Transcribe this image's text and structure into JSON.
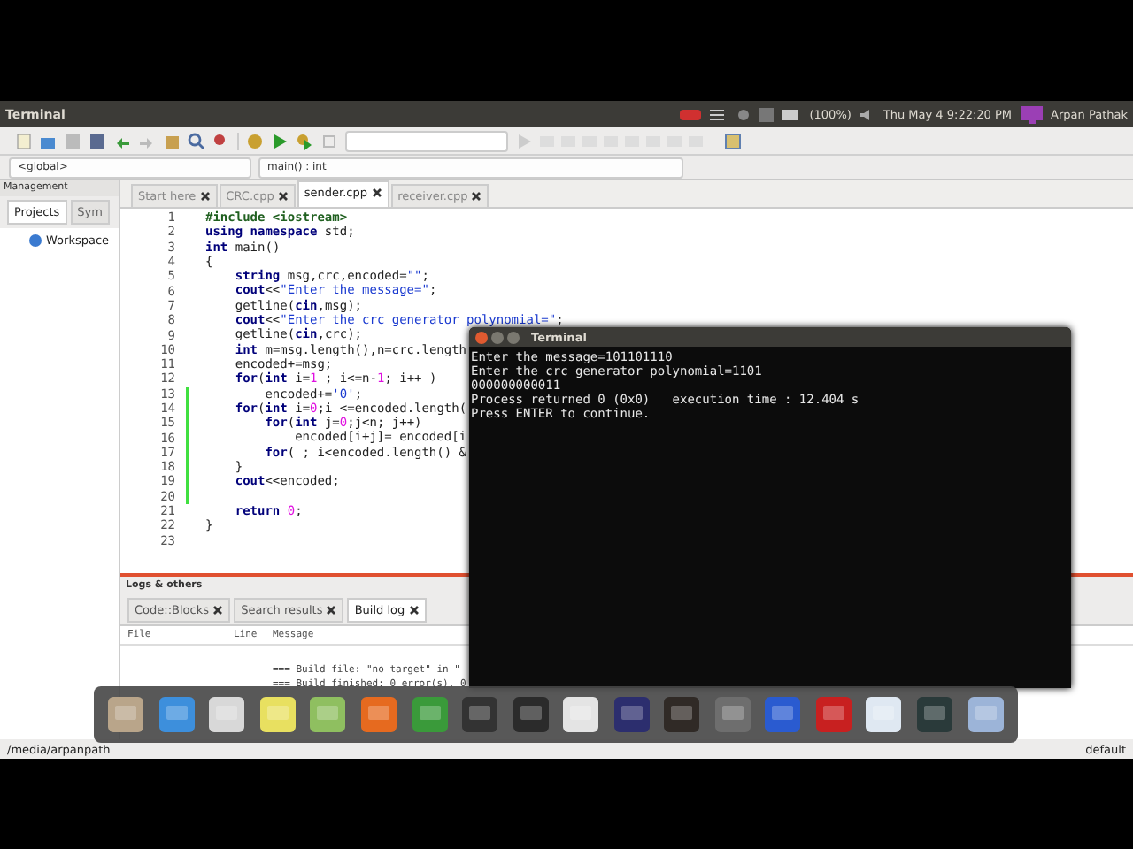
{
  "top_bar": {
    "app_title": "Terminal",
    "battery": "(100%)",
    "clock": "Thu May  4  9:22:20 PM",
    "user": "Arpan Pathak"
  },
  "scope_bar": {
    "scope": "<global>",
    "function": "main() : int"
  },
  "management": {
    "title": "Management",
    "tabs": [
      {
        "label": "Projects",
        "selected": true
      },
      {
        "label": "Sym",
        "selected": false
      }
    ],
    "workspace": "Workspace"
  },
  "editor": {
    "tabs": [
      {
        "label": "Start here",
        "selected": false
      },
      {
        "label": "CRC.cpp",
        "selected": false
      },
      {
        "label": "sender.cpp",
        "selected": true
      },
      {
        "label": "receiver.cpp",
        "selected": false
      }
    ],
    "lines": [
      {
        "number": "1",
        "changed": false,
        "tokens": [
          {
            "kind": "pre",
            "text": "#include <iostream>"
          }
        ]
      },
      {
        "number": "2",
        "changed": false,
        "tokens": [
          {
            "kind": "kw",
            "text": "using namespace"
          },
          {
            "kind": "plain",
            "text": " std;"
          }
        ]
      },
      {
        "number": "3",
        "changed": false,
        "tokens": [
          {
            "kind": "kw",
            "text": "int"
          },
          {
            "kind": "plain",
            "text": " main()"
          }
        ]
      },
      {
        "number": "4",
        "changed": false,
        "tokens": [
          {
            "kind": "plain",
            "text": "{"
          }
        ]
      },
      {
        "number": "5",
        "changed": false,
        "tokens": [
          {
            "kind": "kw",
            "text": "    string"
          },
          {
            "kind": "plain",
            "text": " msg,crc,encoded="
          },
          {
            "kind": "str",
            "text": "\"\""
          },
          {
            "kind": "plain",
            "text": ";"
          }
        ]
      },
      {
        "number": "6",
        "changed": false,
        "tokens": [
          {
            "kind": "kw",
            "text": "    cout"
          },
          {
            "kind": "plain",
            "text": "<<"
          },
          {
            "kind": "str",
            "text": "\"Enter the message=\""
          },
          {
            "kind": "plain",
            "text": ";"
          }
        ]
      },
      {
        "number": "7",
        "changed": false,
        "tokens": [
          {
            "kind": "plain",
            "text": "    getline("
          },
          {
            "kind": "kw",
            "text": "cin"
          },
          {
            "kind": "plain",
            "text": ",msg);"
          }
        ]
      },
      {
        "number": "8",
        "changed": false,
        "tokens": [
          {
            "kind": "kw",
            "text": "    cout"
          },
          {
            "kind": "plain",
            "text": "<<"
          },
          {
            "kind": "str",
            "text": "\"Enter the crc generator polynomial=\""
          },
          {
            "kind": "plain",
            "text": ";"
          }
        ]
      },
      {
        "number": "9",
        "changed": false,
        "tokens": [
          {
            "kind": "plain",
            "text": "    getline("
          },
          {
            "kind": "kw",
            "text": "cin"
          },
          {
            "kind": "plain",
            "text": ",crc);"
          }
        ]
      },
      {
        "number": "10",
        "changed": false,
        "tokens": [
          {
            "kind": "kw",
            "text": "    int"
          },
          {
            "kind": "plain",
            "text": " m=msg.length(),n=crc.length"
          }
        ]
      },
      {
        "number": "11",
        "changed": false,
        "tokens": [
          {
            "kind": "plain",
            "text": "    encoded+=msg;"
          }
        ]
      },
      {
        "number": "12",
        "changed": false,
        "tokens": [
          {
            "kind": "kw",
            "text": "    for"
          },
          {
            "kind": "plain",
            "text": "("
          },
          {
            "kind": "kw",
            "text": "int"
          },
          {
            "kind": "plain",
            "text": " i="
          },
          {
            "kind": "num",
            "text": "1"
          },
          {
            "kind": "plain",
            "text": " ; i<=n-"
          },
          {
            "kind": "num",
            "text": "1"
          },
          {
            "kind": "plain",
            "text": "; i++ )"
          }
        ]
      },
      {
        "number": "13",
        "changed": true,
        "tokens": [
          {
            "kind": "plain",
            "text": "        encoded+="
          },
          {
            "kind": "str",
            "text": "'0'"
          },
          {
            "kind": "plain",
            "text": ";"
          }
        ]
      },
      {
        "number": "14",
        "changed": true,
        "tokens": [
          {
            "kind": "kw",
            "text": "    for"
          },
          {
            "kind": "plain",
            "text": "("
          },
          {
            "kind": "kw",
            "text": "int"
          },
          {
            "kind": "plain",
            "text": " i="
          },
          {
            "kind": "num",
            "text": "0"
          },
          {
            "kind": "plain",
            "text": ";i <=encoded.length("
          }
        ]
      },
      {
        "number": "15",
        "changed": true,
        "tokens": [
          {
            "kind": "kw",
            "text": "        for"
          },
          {
            "kind": "plain",
            "text": "("
          },
          {
            "kind": "kw",
            "text": "int"
          },
          {
            "kind": "plain",
            "text": " j="
          },
          {
            "kind": "num",
            "text": "0"
          },
          {
            "kind": "plain",
            "text": ";j<n; j++)"
          }
        ]
      },
      {
        "number": "16",
        "changed": true,
        "tokens": [
          {
            "kind": "plain",
            "text": "            encoded[i+j]= encoded[i"
          }
        ]
      },
      {
        "number": "17",
        "changed": true,
        "tokens": [
          {
            "kind": "kw",
            "text": "        for"
          },
          {
            "kind": "plain",
            "text": "( ; i<encoded.length() &"
          }
        ]
      },
      {
        "number": "18",
        "changed": true,
        "tokens": [
          {
            "kind": "plain",
            "text": "    }"
          }
        ]
      },
      {
        "number": "19",
        "changed": true,
        "tokens": [
          {
            "kind": "kw",
            "text": "    cout"
          },
          {
            "kind": "plain",
            "text": "<<encoded;"
          }
        ]
      },
      {
        "number": "20",
        "changed": true
      },
      {
        "number": "21",
        "changed": false,
        "tokens": [
          {
            "kind": "kw",
            "text": "    return"
          },
          {
            "kind": "num",
            "text": " 0"
          },
          {
            "kind": "plain",
            "text": ";"
          }
        ]
      },
      {
        "number": "22",
        "changed": false,
        "tokens": [
          {
            "kind": "plain",
            "text": "}"
          }
        ]
      },
      {
        "number": "23",
        "changed": false
      }
    ]
  },
  "logs": {
    "title": "Logs & others",
    "tabs": [
      {
        "label": "Code::Blocks",
        "selected": false
      },
      {
        "label": "Search results",
        "selected": false
      },
      {
        "label": "Build log",
        "selected": true
      }
    ],
    "columns": [
      "File",
      "Line",
      "Message"
    ],
    "rows": [
      {
        "message": "=== Build file: \"no target\" in \""
      },
      {
        "message": "=== Build finished: 0 error(s), 0"
      }
    ]
  },
  "status_bar": {
    "path": "/media/arpanpath",
    "mode": "default"
  },
  "terminal": {
    "title": "Terminal",
    "lines": [
      "Enter the message=101101110",
      "Enter the crc generator polynomial=1101",
      "000000000011",
      "Process returned 0 (0x0)   execution time : 12.404 s",
      "Press ENTER to continue."
    ]
  }
}
